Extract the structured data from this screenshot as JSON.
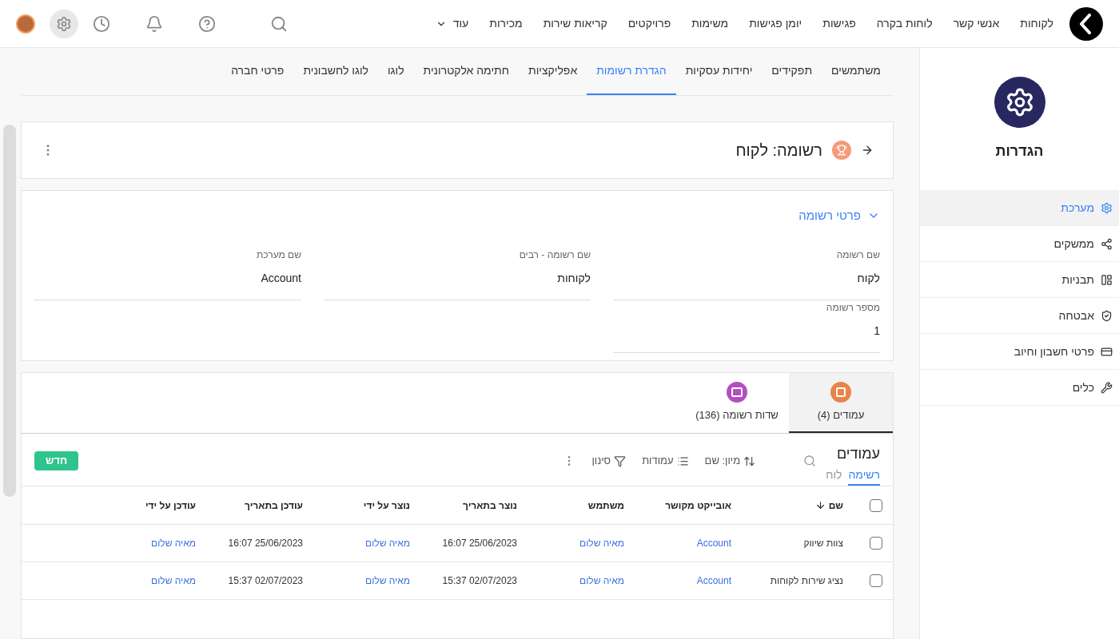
{
  "nav": {
    "items": [
      "לקוחות",
      "אנשי קשר",
      "לוחות בקרה",
      "פגישות",
      "יומן פגישות",
      "משימות",
      "פרויקטים",
      "קריאות שירות",
      "מכירות"
    ],
    "more": "עוד"
  },
  "sidebar": {
    "title": "הגדרות",
    "items": [
      {
        "label": "מערכת",
        "selected": true
      },
      {
        "label": "ממשקים",
        "selected": false
      },
      {
        "label": "תבניות",
        "selected": false
      },
      {
        "label": "אבטחה",
        "selected": false
      },
      {
        "label": "פרטי חשבון וחיוב",
        "selected": false
      },
      {
        "label": "כלים",
        "selected": false
      }
    ]
  },
  "settings_tabs": [
    {
      "label": "משתמשים",
      "selected": false
    },
    {
      "label": "תפקידים",
      "selected": false
    },
    {
      "label": "יחידות עסקיות",
      "selected": false
    },
    {
      "label": "הגדרת רשומות",
      "selected": true
    },
    {
      "label": "אפליקציות",
      "selected": false
    },
    {
      "label": "חתימה אלקטרונית",
      "selected": false
    },
    {
      "label": "לוגו",
      "selected": false
    },
    {
      "label": "לוגו לחשבונית",
      "selected": false
    },
    {
      "label": "פרטי חברה",
      "selected": false
    }
  ],
  "record_header": {
    "title": "רשומה: לקוח"
  },
  "details": {
    "title": "פרטי רשומה",
    "expanded": true,
    "fields": [
      {
        "label": "שם רשומה",
        "value": "לקוח"
      },
      {
        "label": "שם רשומה - רבים",
        "value": "לקוחות"
      },
      {
        "label": "שם מערכת",
        "value": "Account"
      },
      {
        "label": "מספר רשומה",
        "value": "1"
      }
    ]
  },
  "sub_tabs": [
    {
      "label": "עמודים (4)",
      "selected": true
    },
    {
      "label": "שדות רשומה (136)",
      "selected": false
    }
  ],
  "list": {
    "title": "עמודים",
    "views": [
      {
        "label": "רשימה",
        "selected": true
      },
      {
        "label": "לוח",
        "selected": false
      }
    ],
    "sort": "מיון: שם",
    "columns_button": "עמודות",
    "filter": "סינון",
    "new_button": "חדש"
  },
  "table": {
    "header_checked": false,
    "columns": [
      {
        "label": "שם",
        "kind": "text",
        "sorted": true
      },
      {
        "label": "אובייקט מקושר",
        "kind": "link",
        "sorted": false
      },
      {
        "label": "משתמש",
        "kind": "link",
        "sorted": false
      },
      {
        "label": "נוצר בתאריך",
        "kind": "text",
        "sorted": false
      },
      {
        "label": "נוצר על ידי",
        "kind": "link",
        "sorted": false
      },
      {
        "label": "עודכן בתאריך",
        "kind": "text",
        "sorted": false
      },
      {
        "label": "עודכן על ידי",
        "kind": "link",
        "sorted": false
      }
    ],
    "rows": [
      {
        "checked": false,
        "cells": [
          "צוות שיווק",
          "Account",
          "מאיה שלום",
          "16:07 25/06/2023",
          "מאיה שלום",
          "16:07 25/06/2023",
          "מאיה שלום"
        ]
      },
      {
        "checked": false,
        "cells": [
          "נציג שירות לקוחות",
          "Account",
          "מאיה שלום",
          "15:37 02/07/2023",
          "מאיה שלום",
          "15:37 02/07/2023",
          "מאיה שלום"
        ]
      }
    ]
  }
}
